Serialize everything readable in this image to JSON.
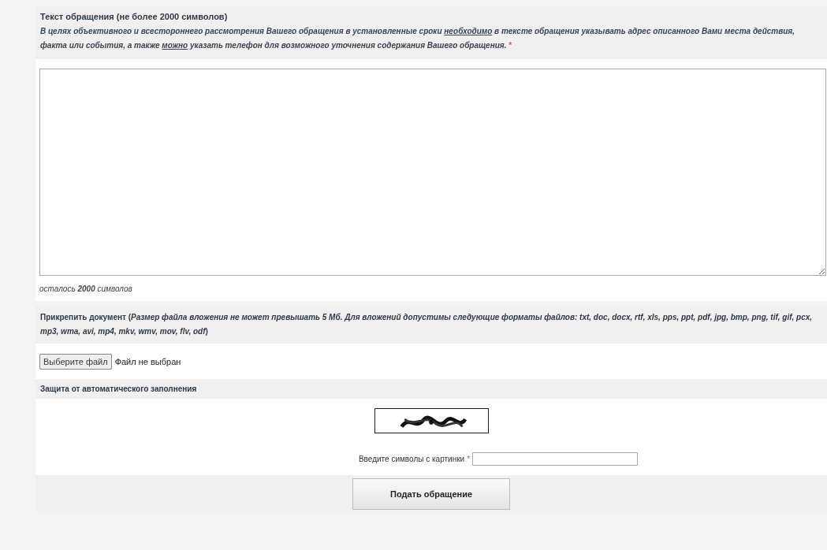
{
  "message": {
    "title": "Текст обращения (не более 2000 символов)",
    "hint": [
      {
        "text": "В целях объективного и всестороннего рассмотрения Вашего обращения в установленные сроки ",
        "underline": false
      },
      {
        "text": "необходимо",
        "underline": true
      },
      {
        "text": " в тексте обращения указывать адрес описанного Вами  места действия, факта или события, а также ",
        "underline": false
      },
      {
        "text": "можно",
        "underline": true
      },
      {
        "text": " указать телефон для возможного уточнения содержания Вашего обращения.",
        "underline": false
      }
    ],
    "required_mark": "*",
    "counter": "осталось **2000** символов"
  },
  "attachment": {
    "title": "Прикрепить документ (*Размер файла вложения не может превышать 5 Мб. Для вложений допустимы следующие форматы файлов: txt, doc, docx, rtf, xls, pps, ppt, pdf, jpg, bmp, png, tif, gif, pcx, mp3, wma, avi, mp4, mkv, wmv, mov, flv, odf*)",
    "button": "Выберите файл",
    "status": "Файл не выбран"
  },
  "captcha": {
    "title": "Защита от автоматического заполнения",
    "label": "Введите символы с картинки",
    "required_mark": "*"
  },
  "submit": "Подать обращение"
}
